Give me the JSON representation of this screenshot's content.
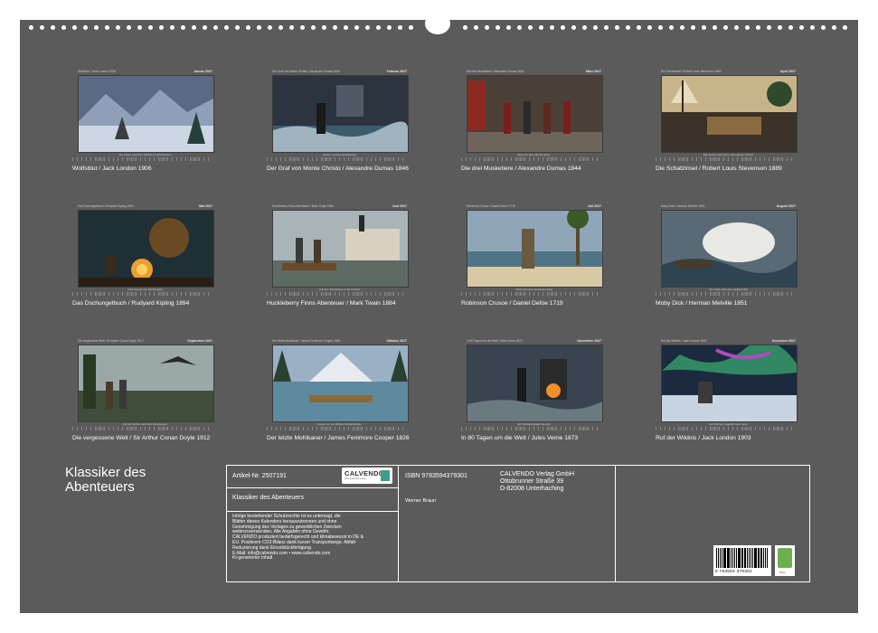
{
  "document": {
    "months": [
      {
        "title": "Wolfsblut / Jack London 1906",
        "month": "Januar 2027",
        "cap": "Wolfsblut / Jack London 1906",
        "desc": "Ein Leben zwischen Wildnis und Zivilisation"
      },
      {
        "title": "Der Graf von Monte Christo / Alexandre Dumas 1846",
        "month": "Februar 2027",
        "cap": "Der Graf von Monte Christo / Alexandre Dumas 1846",
        "desc": "Rache, Verrat und Erlösung"
      },
      {
        "title": "Die drei Musketiere / Alexandre Dumas 1844",
        "month": "März 2027",
        "cap": "Die drei Musketiere / Alexandre Dumas 1844",
        "desc": "Einer für alle, alle für einen"
      },
      {
        "title": "Die Schatzinsel / Robert Louis Stevenson 1889",
        "month": "April 2027",
        "cap": "Die Schatzinsel / Robert Louis Stevenson 1889",
        "desc": "Die Suche nach dem verborgenen Schatz"
      },
      {
        "title": "Das Dschungelbuch / Rudyard Kipling 1894",
        "month": "Mai 2027",
        "cap": "Das Dschungelbuch / Rudyard Kipling 1894",
        "desc": "Das Gesetz des Dschungels"
      },
      {
        "title": "Huckleberry Finns Abenteuer / Mark Twain 1884",
        "month": "Juni 2027",
        "cap": "Huckleberry Finns Abenteuer / Mark Twain 1884",
        "desc": "Auf dem Mississippi in die Freiheit"
      },
      {
        "title": "Robinson Crusoe / Daniel Defoe 1719",
        "month": "Juli 2027",
        "cap": "Robinson Crusoe / Daniel Defoe 1719",
        "desc": "Allein auf einer einsamen Insel"
      },
      {
        "title": "Moby Dick / Herman Melville 1851",
        "month": "August 2027",
        "cap": "Moby Dick / Herman Melville 1851",
        "desc": "Die Jagd nach dem weißen Wal"
      },
      {
        "title": "Die vergessene Welt / Sir Arthur Conan Doyle 1912",
        "month": "September 2027",
        "cap": "Die vergessene Welt / Sir Arthur Conan Doyle 1912",
        "desc": "Auf der Suche nach den Urzeitwesen"
      },
      {
        "title": "Der letzte Mohikaner / James Fenimore Cooper 1826",
        "month": "Oktober 2027",
        "cap": "Der letzte Mohikaner / James Fenimore Cooper 1826",
        "desc": "Kampf um die Wildnis Nordamerikas"
      },
      {
        "title": "In 80 Tagen um die Welt / Jules Verne 1873",
        "month": "November 2027",
        "cap": "In 80 Tagen um die Welt / Jules Verne 1873",
        "desc": "Ein Wettlauf gegen die Zeit"
      },
      {
        "title": "Ruf der Wildnis / Jack London 1903",
        "month": "Dezember 2027",
        "cap": "Ruf der Wildnis / Jack London 1903",
        "desc": "Der Ruf der ungezähmten Natur"
      }
    ],
    "back_title": "Klassiker des Abenteuers",
    "info": {
      "article": "Artikel-Nr. 2507191",
      "calendar_title": "Klassiker des Abenteuers",
      "legal": "Infolge bestehender Schutzrechte ist es untersagt, die Blätter dieses Kalenders herauszutrennen und ohne Genehmigung des Verlages zu gewerblichen Zwecken weiterzuverwenden. Alle Angaben ohne Gewähr. CALVENDO produziert bedarfsgerecht und klimabewusst in DE & EU. Positivere CO2-Bilanz dank kurzer Transportwege. Abfall-Reduzierung dank Einzelstückfertigung. E-Mail: info@calvendo.com • www.calvendo.com KI-generierter Inhalt",
      "legal_lines": [
        "Infolge bestehender Schutzrechte ist es untersagt, die",
        "Blätter dieses Kalenders herauszutrennen und ohne",
        "Genehmigung des Verlages zu gewerblichen Zwecken",
        "weiterzuverwenden. Alle Angaben ohne Gewähr.",
        "CALVENDO produziert bedarfsgerecht und klimabewusst in DE &",
        "EU. Positivere CO2-Bilanz dank kurzer Transportwege. Abfall-",
        "Reduzierung dank Einzelstückfertigung.",
        "E-Mail: info@calvendo.com • www.calvendo.com",
        "KI-generierter Inhalt"
      ],
      "isbn": "ISBN 9783594379301",
      "author": "Werner Braun",
      "publisher_lines": [
        "CALVENDO Verlag GmbH",
        "Ottobrunner Straße 39",
        "D-82008 Unterhaching"
      ],
      "logo_text": "CALVENDO",
      "logo_sub": "Dein Kalenderverlag",
      "barcode_number": "9 783594 379301",
      "eco_label": "eco"
    },
    "colors": {
      "sheet": "#5b5b5b",
      "text": "#ffffff",
      "accent": "#3a9d8f"
    }
  }
}
